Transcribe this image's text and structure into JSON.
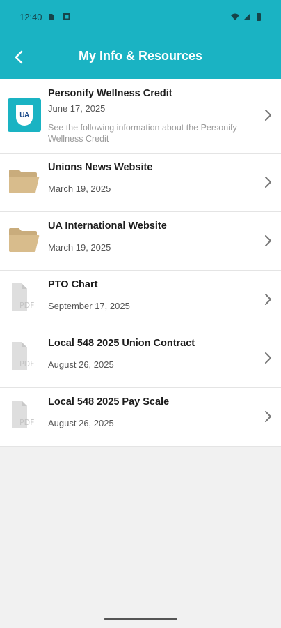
{
  "status_bar": {
    "time": "12:40"
  },
  "header": {
    "title": "My Info & Resources",
    "accent_color": "#1ab3c3"
  },
  "items": [
    {
      "title": "Personify Wellness Credit",
      "date": "June 17, 2025",
      "description": "See the following information about the Personify Wellness Credit",
      "icon": "ua-logo-icon",
      "logo_text": "UA"
    },
    {
      "title": "Unions News Website",
      "date": "March 19, 2025",
      "icon": "folder-icon"
    },
    {
      "title": "UA International Website",
      "date": "March 19, 2025",
      "icon": "folder-icon"
    },
    {
      "title": "PTO Chart",
      "date": "September 17, 2025",
      "icon": "pdf-icon",
      "icon_label": "PDF"
    },
    {
      "title": "Local 548 2025 Union Contract",
      "date": "August 26, 2025",
      "icon": "pdf-icon",
      "icon_label": "PDF"
    },
    {
      "title": "Local 548 2025 Pay Scale",
      "date": "August 26, 2025",
      "icon": "pdf-icon",
      "icon_label": "PDF"
    }
  ]
}
